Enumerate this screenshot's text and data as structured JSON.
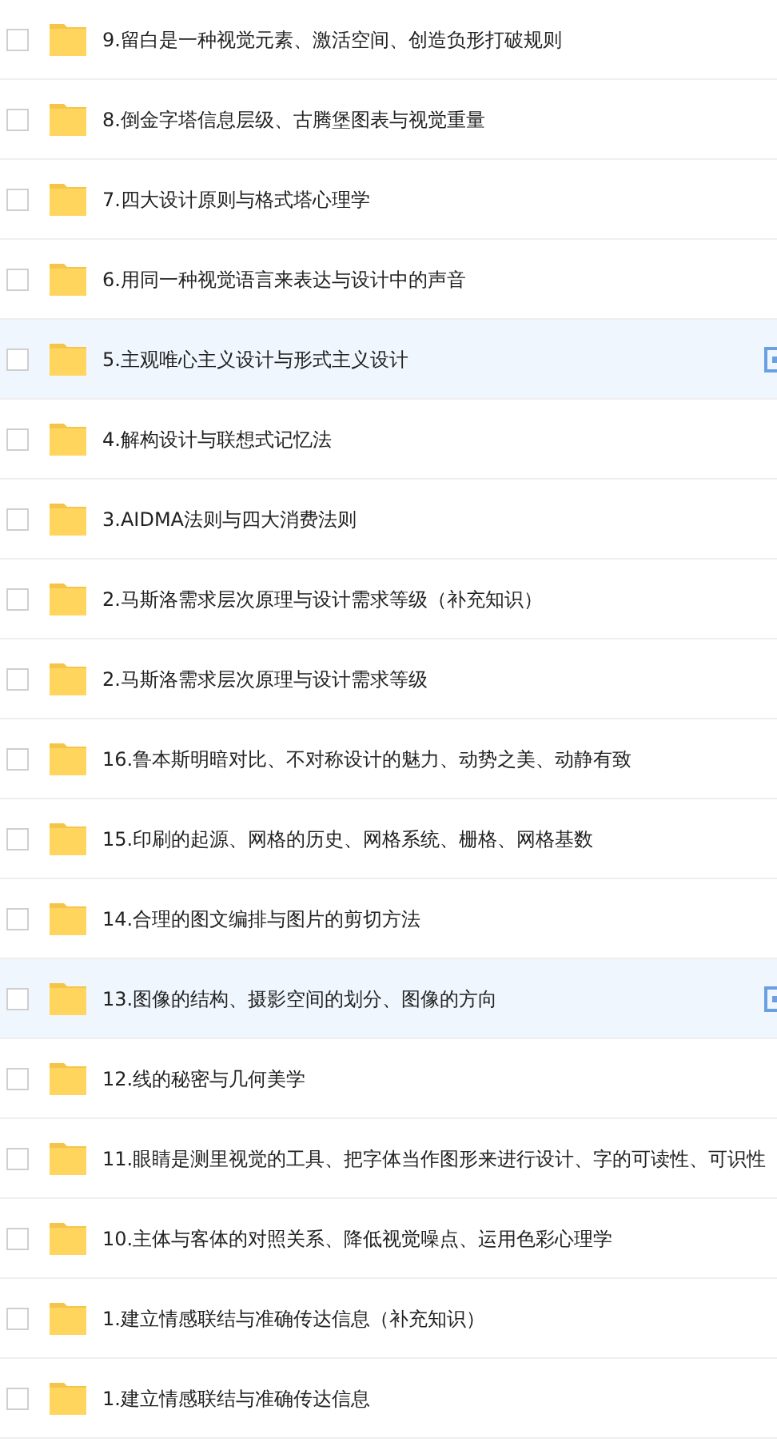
{
  "folders": [
    {
      "name": "9.留白是一种视觉元素、激活空间、创造负形打破规则",
      "checked": false,
      "hovered": false
    },
    {
      "name": "8.倒金字塔信息层级、古腾堡图表与视觉重量",
      "checked": false,
      "hovered": false
    },
    {
      "name": "7.四大设计原则与格式塔心理学",
      "checked": false,
      "hovered": false
    },
    {
      "name": "6.用同一种视觉语言来表达与设计中的声音",
      "checked": false,
      "hovered": false
    },
    {
      "name": "5.主观唯心主义设计与形式主义设计",
      "checked": false,
      "hovered": true
    },
    {
      "name": "4.解构设计与联想式记忆法",
      "checked": false,
      "hovered": false
    },
    {
      "name": "3.AIDMA法则与四大消费法则",
      "checked": false,
      "hovered": false
    },
    {
      "name": "2.马斯洛需求层次原理与设计需求等级（补充知识）",
      "checked": false,
      "hovered": false
    },
    {
      "name": "2.马斯洛需求层次原理与设计需求等级",
      "checked": false,
      "hovered": false
    },
    {
      "name": "16.鲁本斯明暗对比、不对称设计的魅力、动势之美、动静有致",
      "checked": false,
      "hovered": false
    },
    {
      "name": "15.印刷的起源、网格的历史、网格系统、栅格、网格基数",
      "checked": false,
      "hovered": false
    },
    {
      "name": "14.合理的图文编排与图片的剪切方法",
      "checked": false,
      "hovered": false
    },
    {
      "name": "13.图像的结构、摄影空间的划分、图像的方向",
      "checked": false,
      "hovered": true
    },
    {
      "name": "12.线的秘密与几何美学",
      "checked": false,
      "hovered": false
    },
    {
      "name": "11.眼睛是测里视觉的工具、把字体当作图形来进行设计、字的可读性、可识性",
      "checked": false,
      "hovered": false
    },
    {
      "name": "10.主体与客体的对照关系、降低视觉噪点、运用色彩心理学",
      "checked": false,
      "hovered": false
    },
    {
      "name": "1.建立情感联结与准确传达信息（补充知识）",
      "checked": false,
      "hovered": false
    },
    {
      "name": "1.建立情感联结与准确传达信息",
      "checked": false,
      "hovered": false
    }
  ]
}
